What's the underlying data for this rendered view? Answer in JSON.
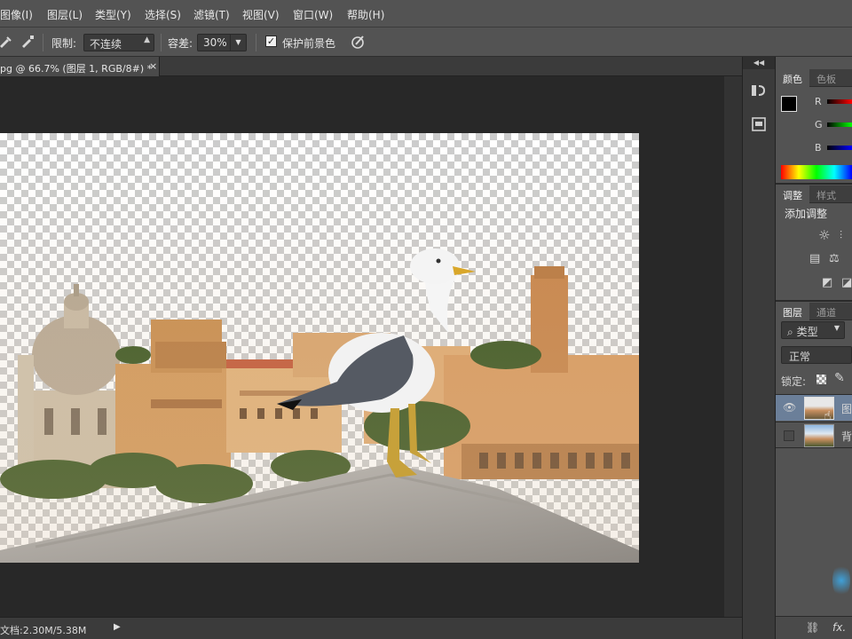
{
  "menu": [
    "图像(I)",
    "图层(L)",
    "类型(Y)",
    "选择(S)",
    "滤镜(T)",
    "视图(V)",
    "窗口(W)",
    "帮助(H)"
  ],
  "options": {
    "limit_label": "限制:",
    "limit_value": "不连续",
    "tolerance_label": "容差:",
    "tolerance_value": "30%",
    "protect_label": "保护前景色",
    "protect_checked": true
  },
  "document": {
    "tab_title": "pg @ 66.7% (图层 1, RGB/8#) *",
    "close_glyph": "×",
    "status": "文档:2.30M/5.38M"
  },
  "color_panel": {
    "tabs": [
      "颜色",
      "色板"
    ],
    "channels": [
      "R",
      "G",
      "B"
    ]
  },
  "adjust_panel": {
    "tabs": [
      "调整",
      "样式"
    ],
    "title": "添加调整"
  },
  "layers_panel": {
    "tabs": [
      "图层",
      "通道"
    ],
    "filter_value": "类型",
    "blend_mode": "正常",
    "lock_label": "锁定:",
    "layers": [
      {
        "name_fragment": "图",
        "visible": true,
        "selected": true
      },
      {
        "name_fragment": "背",
        "visible": false,
        "selected": false
      }
    ],
    "fx_label": "fx."
  },
  "colors": {
    "ui_dark": "#282828",
    "panel": "#535353",
    "accent_selected": "#6b7f99"
  }
}
